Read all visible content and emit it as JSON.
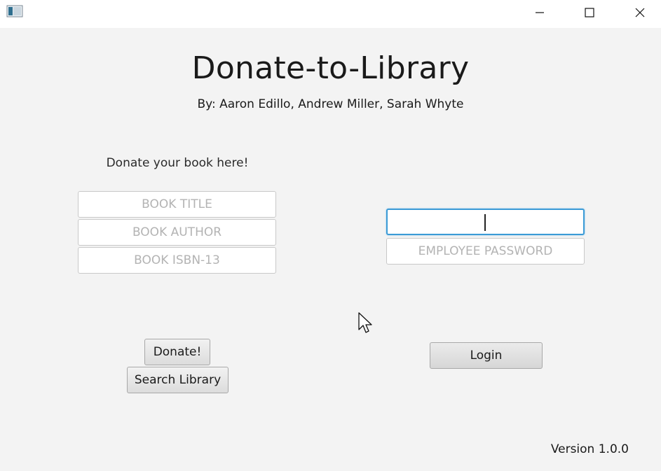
{
  "window": {
    "controls": {
      "minimize_icon": "minimize-icon",
      "maximize_icon": "maximize-icon",
      "close_icon": "close-icon"
    }
  },
  "header": {
    "title": "Donate-to-Library",
    "authors": "By: Aaron Edillo, Andrew Miller, Sarah Whyte"
  },
  "donate": {
    "heading": "Donate your book here!",
    "fields": {
      "title_placeholder": "BOOK TITLE",
      "author_placeholder": "BOOK AUTHOR",
      "isbn_placeholder": "BOOK ISBN-13"
    },
    "donate_label": "Donate!",
    "search_label": "Search Library"
  },
  "login": {
    "username_value": "",
    "password_placeholder": "EMPLOYEE PASSWORD",
    "login_label": "Login"
  },
  "footer": {
    "version": "Version 1.0.0"
  },
  "colors": {
    "focus_border": "#3c9bd6",
    "background": "#f3f3f3"
  }
}
